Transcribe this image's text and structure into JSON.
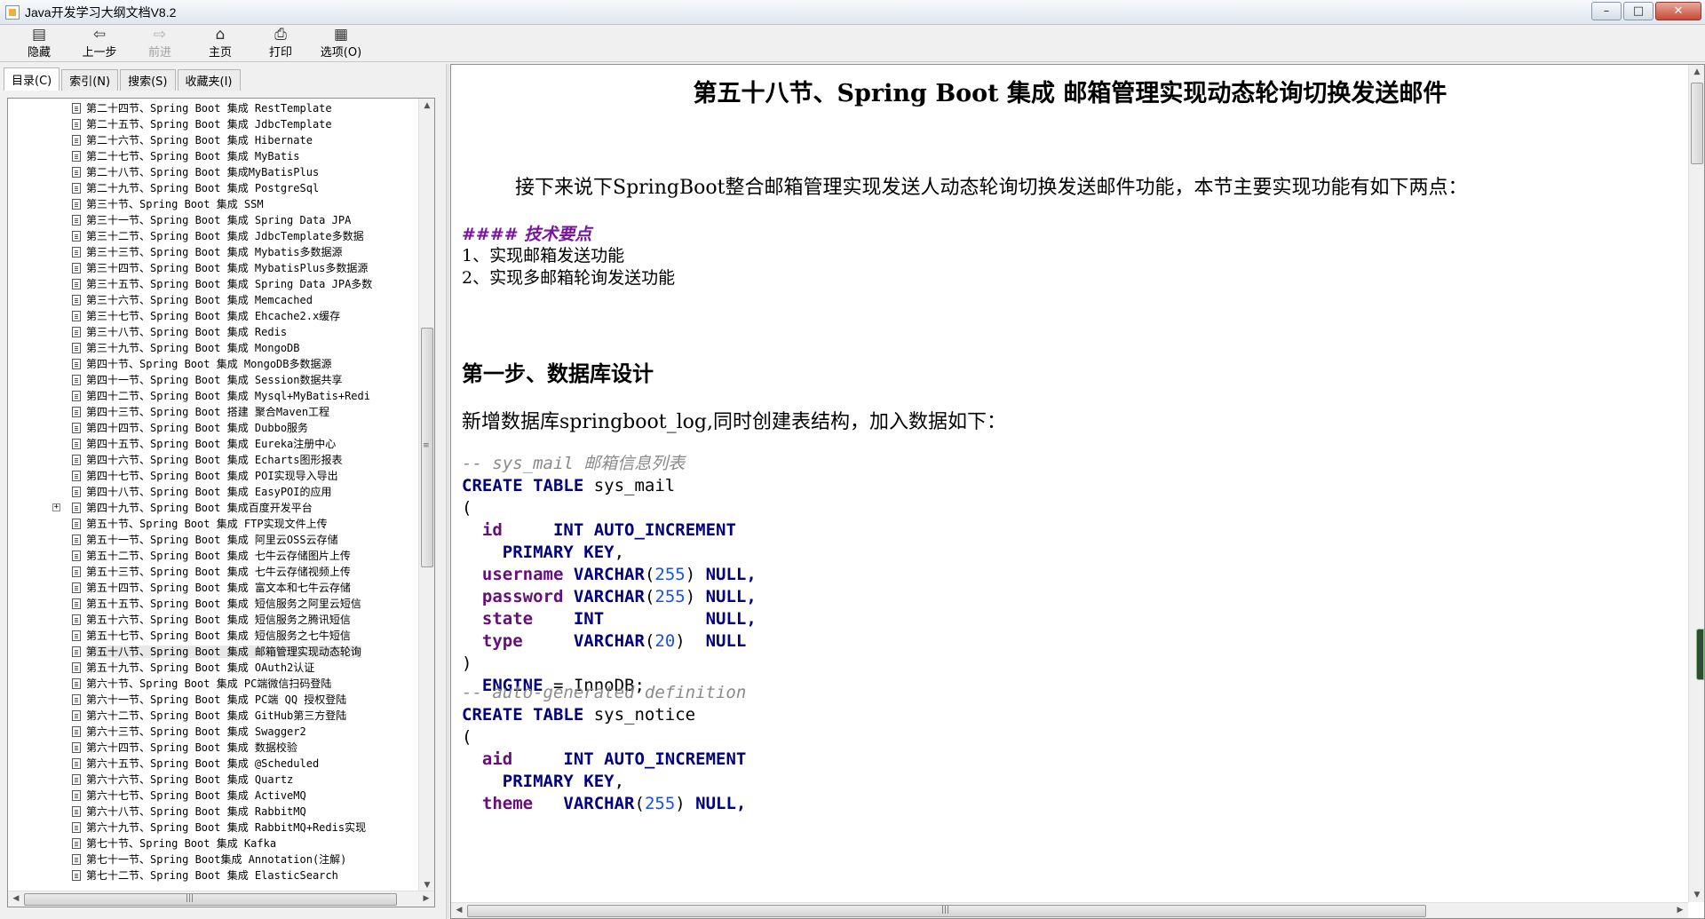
{
  "window": {
    "title": "Java开发学习大纲文档V8.2",
    "controls": [
      "–",
      "□",
      "✕"
    ]
  },
  "toolbar": {
    "items": [
      {
        "label": "隐藏",
        "icon": "hide-icon",
        "enabled": true
      },
      {
        "label": "上一步",
        "icon": "back-icon",
        "enabled": true
      },
      {
        "label": "前进",
        "icon": "forward-icon",
        "enabled": false
      },
      {
        "label": "主页",
        "icon": "home-icon",
        "enabled": true
      },
      {
        "label": "打印",
        "icon": "print-icon",
        "enabled": true
      },
      {
        "label": "选项(O)",
        "icon": "options-icon",
        "enabled": true
      }
    ]
  },
  "tabs": [
    {
      "label": "目录(C)",
      "active": true
    },
    {
      "label": "索引(N)",
      "active": false
    },
    {
      "label": "搜索(S)",
      "active": false
    },
    {
      "label": "收藏夹(I)",
      "active": false
    }
  ],
  "tree": {
    "items": [
      "第二十四节、Spring Boot 集成 RestTemplate",
      "第二十五节、Spring Boot 集成 JdbcTemplate",
      "第二十六节、Spring Boot 集成 Hibernate",
      "第二十七节、Spring Boot 集成 MyBatis",
      "第二十八节、Spring Boot 集成MyBatisPlus",
      "第二十九节、Spring Boot 集成 PostgreSql",
      "第三十节、Spring Boot 集成 SSM",
      "第三十一节、Spring Boot 集成 Spring Data JPA",
      "第三十二节、Spring Boot 集成 JdbcTemplate多数据",
      "第三十三节、Spring Boot 集成 Mybatis多数据源",
      "第三十四节、Spring Boot 集成 MybatisPlus多数据源",
      "第三十五节、Spring Boot 集成 Spring Data JPA多数",
      "第三十六节、Spring Boot 集成 Memcached",
      "第三十七节、Spring Boot 集成 Ehcache2.x缓存",
      "第三十八节、Spring Boot 集成 Redis",
      "第三十九节、Spring Boot 集成 MongoDB",
      "第四十节、Spring Boot 集成 MongoDB多数据源",
      "第四十一节、Spring Boot 集成 Session数据共享",
      "第四十二节、Spring Boot 集成 Mysql+MyBatis+Redi",
      "第四十三节、Spring Boot 搭建 聚合Maven工程",
      "第四十四节、Spring Boot 集成 Dubbo服务",
      "第四十五节、Spring Boot 集成 Eureka注册中心",
      "第四十六节、Spring Boot 集成 Echarts图形报表",
      "第四十七节、Spring Boot 集成 POI实现导入导出",
      "第四十八节、Spring Boot 集成 EasyPOI的应用",
      "第四十九节、Spring Boot 集成百度开发平台",
      "第五十节、Spring Boot 集成 FTP实现文件上传",
      "第五十一节、Spring Boot 集成 阿里云OSS云存储",
      "第五十二节、Spring Boot 集成 七牛云存储图片上传",
      "第五十三节、Spring Boot 集成 七牛云存储视频上传",
      "第五十四节、Spring Boot 集成 富文本和七牛云存储",
      "第五十五节、Spring Boot 集成 短信服务之阿里云短信",
      "第五十六节、Spring Boot 集成 短信服务之腾讯短信",
      "第五十七节、Spring Boot 集成 短信服务之七牛短信",
      "第五十八节、Spring Boot 集成 邮箱管理实现动态轮询",
      "第五十九节、Spring Boot 集成 OAuth2认证",
      "第六十节、Spring Boot 集成 PC端微信扫码登陆",
      "第六十一节、Spring Boot 集成 PC端 QQ 授权登陆",
      "第六十二节、Spring Boot 集成 GitHub第三方登陆",
      "第六十三节、Spring Boot 集成 Swagger2",
      "第六十四节、Spring Boot 集成 数据校验",
      "第六十五节、Spring Boot 集成 @Scheduled",
      "第六十六节、Spring Boot 集成 Quartz",
      "第六十七节、Spring Boot 集成 ActiveMQ",
      "第六十八节、Spring Boot 集成 RabbitMQ",
      "第六十九节、Spring Boot 集成 RabbitMQ+Redis实现",
      "第七十节、Spring Boot 集成 Kafka",
      "第七十一节、Spring Boot集成 Annotation(注解)",
      "第七十二节、Spring Boot 集成 ElasticSearch"
    ],
    "selected_index": 34,
    "expander_index": 25,
    "expander_symbol": "+"
  },
  "content": {
    "title": "第五十八节、Spring Boot 集成 邮箱管理实现动态轮询切换发送邮件",
    "intro": "接下来说下SpringBoot整合邮箱管理实现发送人动态轮询切换发送邮件功能，本节主要实现功能有如下两点：",
    "tech_heading": "#### 技术要点",
    "points": [
      "1、实现邮箱发送功能",
      "2、实现多邮箱轮询发送功能"
    ],
    "step_heading": "第一步、数据库设计",
    "step_desc": "新增数据库springboot_log,同时创建表结构，加入数据如下：",
    "code1": {
      "comment": "-- sys_mail 邮箱信息列表",
      "create": "CREATE TABLE",
      "table": "sys_mail",
      "open": "(",
      "close": ")",
      "rows": [
        {
          "field": "id",
          "type": "INT AUTO_INCREMENT",
          "len": "",
          "tail": ""
        },
        {
          "field": "",
          "type": "PRIMARY KEY",
          "len": "",
          "tail": ","
        },
        {
          "field": "username",
          "type": "VARCHAR",
          "len": "255",
          "tail": "NULL,"
        },
        {
          "field": "password",
          "type": "VARCHAR",
          "len": "255",
          "tail": "NULL,"
        },
        {
          "field": "state",
          "type": "INT",
          "len": "",
          "tail": "NULL,"
        },
        {
          "field": "type",
          "type": "VARCHAR",
          "len": "20",
          "tail": "NULL"
        }
      ],
      "engine_kw": "ENGINE",
      "engine_val": "= InnoDB;"
    },
    "code2": {
      "comment": "-- auto-generated definition",
      "create": "CREATE TABLE",
      "table": "sys_notice",
      "open": "(",
      "rows": [
        {
          "field": "aid",
          "type": "INT AUTO_INCREMENT",
          "len": "",
          "tail": ""
        },
        {
          "field": "",
          "type": "PRIMARY KEY",
          "len": "",
          "tail": ","
        },
        {
          "field": "theme",
          "type": "VARCHAR",
          "len": "255",
          "tail": "NULL,"
        }
      ]
    }
  },
  "colors": {
    "keyword": "#000080",
    "field": "#660e7a",
    "number": "#1750eb",
    "comment": "#8a8a8a",
    "heading4": "#7a14a0"
  }
}
